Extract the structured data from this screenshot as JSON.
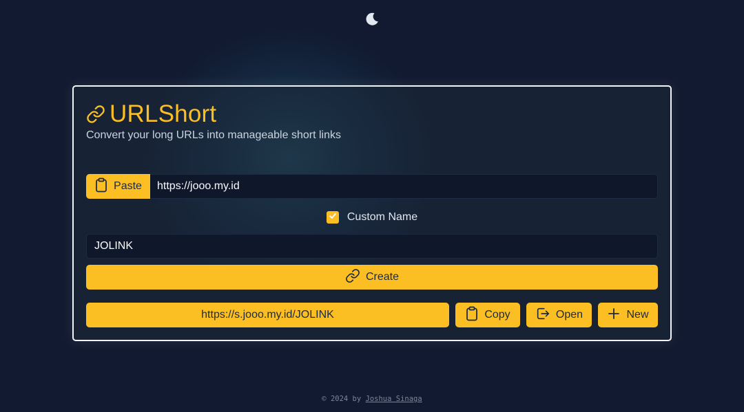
{
  "app": {
    "title": "URLShort",
    "subtitle": "Convert your long URLs into manageable short links"
  },
  "url_input": {
    "paste_label": "Paste",
    "value": "https://jooo.my.id"
  },
  "custom_name": {
    "label": "Custom Name",
    "checked": true,
    "value": "JOLINK"
  },
  "create_label": "Create",
  "result": {
    "short_url": "https://s.jooo.my.id/JOLINK",
    "copy_label": "Copy",
    "open_label": "Open",
    "new_label": "New"
  },
  "footer": {
    "prefix": "© 2024 by ",
    "author": "Joshua Sinaga"
  },
  "colors": {
    "accent": "#fbbf24",
    "background": "#111a30",
    "input_bg": "#0f172a",
    "text_light": "#f8fafc"
  },
  "icons": {
    "theme_toggle": "moon-icon",
    "title": "link-icon",
    "paste": "clipboard-icon",
    "checkbox": "check-icon",
    "create": "link-icon",
    "copy": "clipboard-icon",
    "open": "external-open-icon",
    "new": "plus-icon"
  }
}
